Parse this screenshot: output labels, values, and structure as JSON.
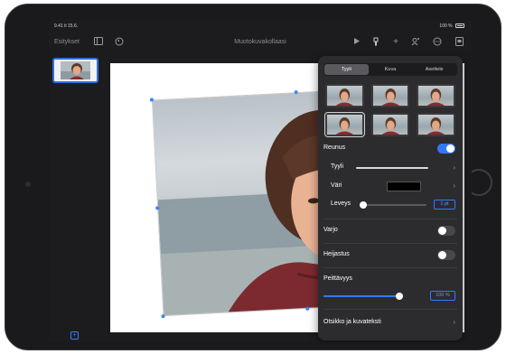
{
  "status_bar": {
    "time": "9.41 ti 15.6.",
    "battery": "100 %"
  },
  "toolbar": {
    "present_label": "Esitykset",
    "document_title": "Muotokuvakollaasi",
    "icons": [
      "sidebar-icon",
      "undo-icon",
      "play-icon",
      "format-brush-icon",
      "add-icon",
      "share-icon",
      "more-icon",
      "document-icon"
    ]
  },
  "popover": {
    "tabs": [
      {
        "label": "Tyyli",
        "active": true
      },
      {
        "label": "Kuva",
        "active": false
      },
      {
        "label": "Asettele",
        "active": false
      }
    ],
    "border": {
      "label": "Reunus",
      "enabled": true,
      "style_label": "Tyyli",
      "color_label": "Väri",
      "color_value": "#000000",
      "width_label": "Leveys",
      "width_value": "1 pt",
      "width_level": 0.05
    },
    "shadow": {
      "label": "Varjo",
      "enabled": false
    },
    "reflection": {
      "label": "Heijastus",
      "enabled": false
    },
    "opacity": {
      "label": "Peittävyys",
      "value": "100 %",
      "level": 1.0
    },
    "caption": {
      "label": "Otsikko ja kuvateksti"
    }
  },
  "colors": {
    "accent": "#3478f6",
    "popover_bg": "#2c2c2e",
    "screen_bg": "#1c1c1e"
  }
}
